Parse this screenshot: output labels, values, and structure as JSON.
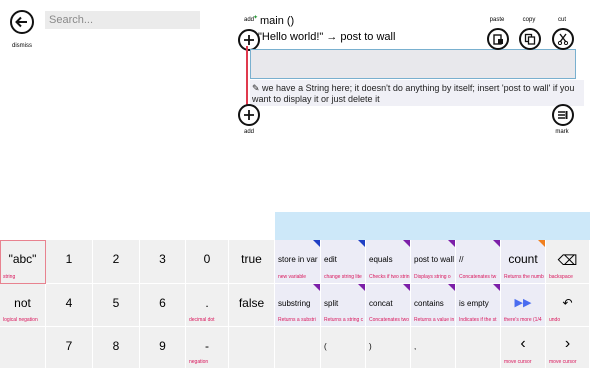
{
  "dismiss": {
    "label": "dismiss",
    "icon": "back-arrow-icon"
  },
  "search": {
    "placeholder": "Search..."
  },
  "code": {
    "add_top_label": "add",
    "header_text": "main ()",
    "statement_text": "\"Hello world!\" → post to wall",
    "comment_text": "✎ we have a String here; it doesn't do anything by itself; insert 'post to wall' if you want to display it or just delete it",
    "add_bottom_label": "add",
    "mark_label": "mark"
  },
  "toolbar": {
    "paste_label": "paste",
    "copy_label": "copy",
    "cut_label": "cut"
  },
  "keyboard": {
    "row1": [
      {
        "main": "\"abc\"",
        "sub": "string"
      },
      {
        "main": "1",
        "sub": ""
      },
      {
        "main": "2",
        "sub": ""
      },
      {
        "main": "3",
        "sub": ""
      },
      {
        "main": "0",
        "sub": ""
      },
      {
        "main": "true",
        "sub": ""
      },
      {
        "main": "store in var",
        "sub": "new variable",
        "corner": "#1f3fc4"
      },
      {
        "main": "edit",
        "sub": "change string lite",
        "corner": "#1f3fc4"
      },
      {
        "main": "equals",
        "sub": "Checks if two strin",
        "corner": "#7c1fa8"
      },
      {
        "main": "post to wall",
        "sub": "Displays string o",
        "corner": "#7c1fa8"
      },
      {
        "main": "//",
        "sub": "Concatenates tw",
        "corner": "#7c1fa8"
      },
      {
        "main": "count",
        "sub": "Returns the numb",
        "corner": "#f07f1f"
      },
      {
        "main": "⌫",
        "sub": "backspace"
      }
    ],
    "row2": [
      {
        "main": "not",
        "sub": "logical negation"
      },
      {
        "main": "4",
        "sub": ""
      },
      {
        "main": "5",
        "sub": ""
      },
      {
        "main": "6",
        "sub": ""
      },
      {
        "main": ".",
        "sub": "decimal dot"
      },
      {
        "main": "false",
        "sub": ""
      },
      {
        "main": "substring",
        "sub": "Returns a substri",
        "corner": "#7c1fa8"
      },
      {
        "main": "split",
        "sub": "Returns a string c",
        "corner": "#7c1fa8"
      },
      {
        "main": "concat",
        "sub": "Concatenates two",
        "corner": "#7c1fa8"
      },
      {
        "main": "contains",
        "sub": "Returns a value in",
        "corner": "#7c1fa8"
      },
      {
        "main": "is empty",
        "sub": "Indicates if the st",
        "corner": "#7c1fa8"
      },
      {
        "main": "▶▶",
        "sub": "there's more (1/4"
      },
      {
        "main": "↶",
        "sub": "undo"
      }
    ],
    "row3": [
      {
        "main": "",
        "sub": ""
      },
      {
        "main": "7",
        "sub": ""
      },
      {
        "main": "8",
        "sub": ""
      },
      {
        "main": "9",
        "sub": ""
      },
      {
        "main": "-",
        "sub": "negation"
      },
      {
        "main": "",
        "sub": ""
      },
      {
        "main": "",
        "sub": ""
      },
      {
        "main": "(",
        "sub": ""
      },
      {
        "main": ")",
        "sub": ""
      },
      {
        "main": ",",
        "sub": ""
      },
      {
        "main": "",
        "sub": ""
      },
      {
        "main": "‹",
        "sub": "move cursor"
      },
      {
        "main": "›",
        "sub": "move cursor"
      }
    ]
  },
  "colors": {
    "accent_blue": "#cde8f9",
    "label_red": "#d9145a",
    "more_arrows": "#4a6cf0"
  }
}
